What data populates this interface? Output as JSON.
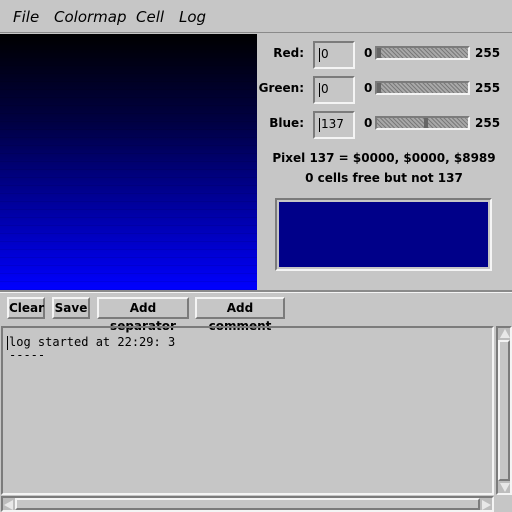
{
  "menubar": {
    "items": [
      {
        "label": "File"
      },
      {
        "label": "Colormap"
      },
      {
        "label": "Cell"
      },
      {
        "label": "Log"
      }
    ]
  },
  "colors": {
    "swatch": "#000089",
    "gradient_top": "#000000",
    "gradient_bottom": "#0000ff"
  },
  "controls": {
    "red": {
      "label": "Red:",
      "value": "0",
      "min": "0",
      "max": "255",
      "level": 0
    },
    "green": {
      "label": "Green:",
      "value": "0",
      "min": "0",
      "max": "255",
      "level": 0
    },
    "blue": {
      "label": "Blue:",
      "value": "137",
      "min": "0",
      "max": "255",
      "level": 0.537
    }
  },
  "pixel_info": "Pixel 137  =  $0000, $0000, $8989",
  "cells_info": "0 cells free but not 137",
  "buttons": {
    "clear": "Clear",
    "save": "Save",
    "add_separator": "Add separator",
    "add_comment": "Add comment"
  },
  "log": {
    "lines": "log started at 22:29: 3\n-----"
  }
}
